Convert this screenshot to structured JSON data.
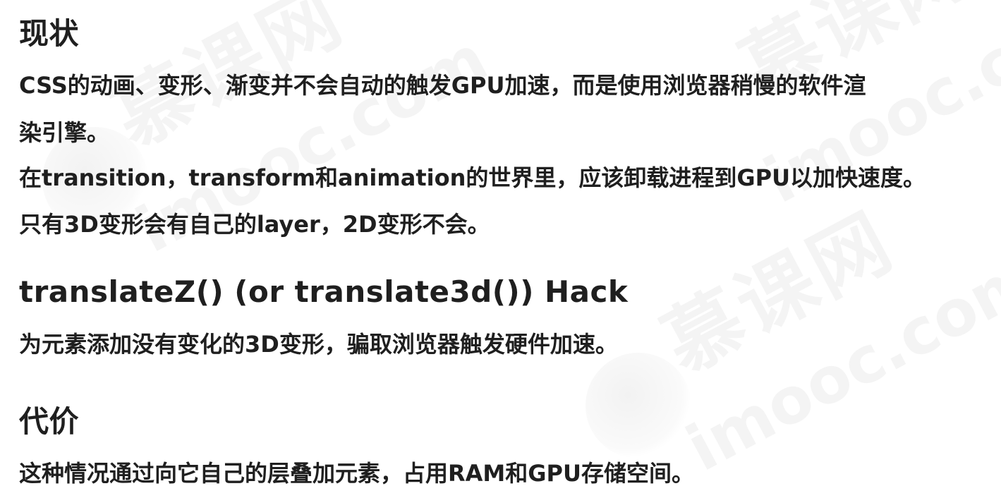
{
  "watermark": {
    "chinese": "慕课网",
    "english": "imooc.com"
  },
  "sections": {
    "status": {
      "heading": "现状",
      "line1": "CSS的动画、变形、渐变并不会自动的触发GPU加速，而是使用浏览器稍慢的软件渲",
      "line2": "染引擎。",
      "line3": "在transition，transform和animation的世界里，应该卸载进程到GPU以加快速度。",
      "line4": "只有3D变形会有自己的layer，2D变形不会。"
    },
    "hack": {
      "heading": "translateZ() (or translate3d()) Hack",
      "line1": "为元素添加没有变化的3D变形，骗取浏览器触发硬件加速。"
    },
    "cost": {
      "heading": "代价",
      "line1": "这种情况通过向它自己的层叠加元素，占用RAM和GPU存储空间。"
    }
  }
}
